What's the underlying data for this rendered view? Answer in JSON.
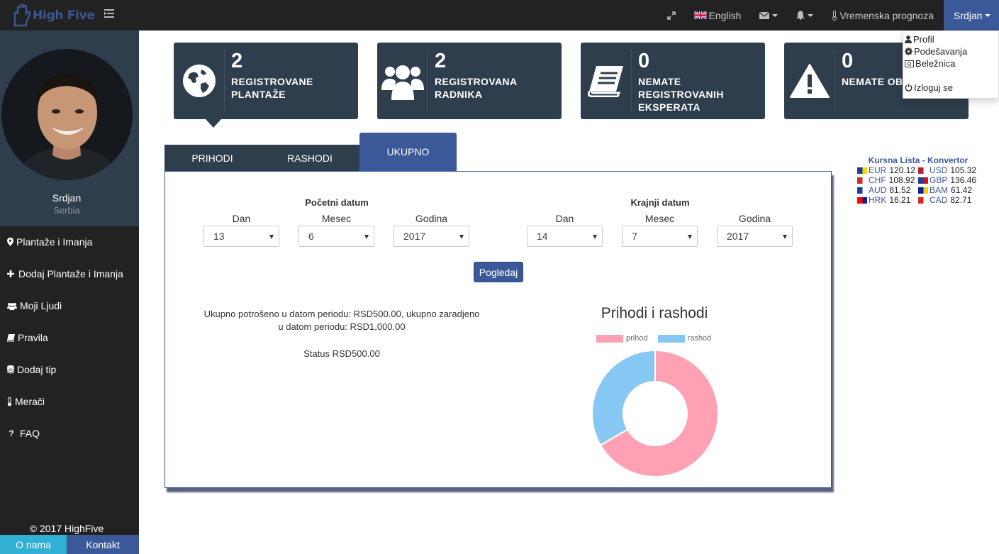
{
  "brand": {
    "name": "High Five",
    "color": "#3b5998"
  },
  "navbar": {
    "language": "English",
    "weather": "Vremenska prognoza",
    "user": "Srdjan"
  },
  "user_menu": {
    "items": [
      {
        "label": "Profil",
        "icon": "user-icon"
      },
      {
        "label": "Podešavanja",
        "icon": "gear-icon"
      },
      {
        "label": "Beležnica",
        "icon": "notebook-icon"
      },
      {
        "label": "Izloguj se",
        "icon": "power-icon"
      }
    ]
  },
  "sidebar": {
    "profile_name": "Srdjan",
    "profile_country": "Serbia",
    "items": [
      {
        "label": "Plantaže i Imanja",
        "icon": "map-marker-icon"
      },
      {
        "label": "Dodaj Plantaže i Imanja",
        "icon": "plus-icon"
      },
      {
        "label": "Moji Ljudi",
        "icon": "users-icon"
      },
      {
        "label": "Pravila",
        "icon": "book-icon"
      },
      {
        "label": "Dodaj tip",
        "icon": "database-icon"
      },
      {
        "label": "Merači",
        "icon": "thermometer-icon"
      },
      {
        "label": "FAQ",
        "icon": "question-icon"
      }
    ],
    "copyright": "© 2017 HighFive",
    "footer_about": "O nama",
    "footer_contact": "Kontakt"
  },
  "cards": [
    {
      "number": "2",
      "label": "REGISTROVANE PLANTAŽE",
      "icon": "globe-icon"
    },
    {
      "number": "2",
      "label": "REGISTROVANA RADNIKA",
      "icon": "users-icon"
    },
    {
      "number": "0",
      "label": "NEMATE REGISTROVANIH EKSPERATA",
      "icon": "book-icon"
    },
    {
      "number": "0",
      "label": "NEMATE OB",
      "icon": "warning-icon"
    }
  ],
  "tabs": [
    {
      "label": "PRIHODI",
      "active": false
    },
    {
      "label": "RASHODI",
      "active": false
    },
    {
      "label": "UKUPNO",
      "active": true
    }
  ],
  "form": {
    "start_title": "Početni datum",
    "end_title": "Krajnji datum",
    "day_label": "Dan",
    "month_label": "Mesec",
    "year_label": "Godina",
    "start_day": "13",
    "start_month": "6",
    "start_year": "2017",
    "end_day": "14",
    "end_month": "7",
    "end_year": "2017",
    "submit": "Pogledaj"
  },
  "summary": {
    "text": "Ukupno potrošeno u datom periodu: RSD500.00, ukupno zaradjeno u datom periodu: RSD1,000.00",
    "status": "Status RSD500.00"
  },
  "chart_data": {
    "type": "pie",
    "title": "Prihodi i rashodi",
    "categories": [
      "prihod",
      "rashod"
    ],
    "values": [
      1000,
      500
    ],
    "colors": [
      "#ffa1b5",
      "#86c7f3"
    ],
    "legend": "top",
    "donut": true
  },
  "currency": {
    "title": "Kursna Lista - Konvertor",
    "rows": [
      [
        {
          "code": "EUR",
          "value": "120.12"
        },
        {
          "code": "USD",
          "value": "105.32"
        }
      ],
      [
        {
          "code": "CHF",
          "value": "108.92"
        },
        {
          "code": "GBP",
          "value": "136.46"
        }
      ],
      [
        {
          "code": "AUD",
          "value": "81.52"
        },
        {
          "code": "BAM",
          "value": "61.42"
        }
      ],
      [
        {
          "code": "HRK",
          "value": "16.21"
        },
        {
          "code": "CAD",
          "value": "82.71"
        }
      ]
    ]
  }
}
